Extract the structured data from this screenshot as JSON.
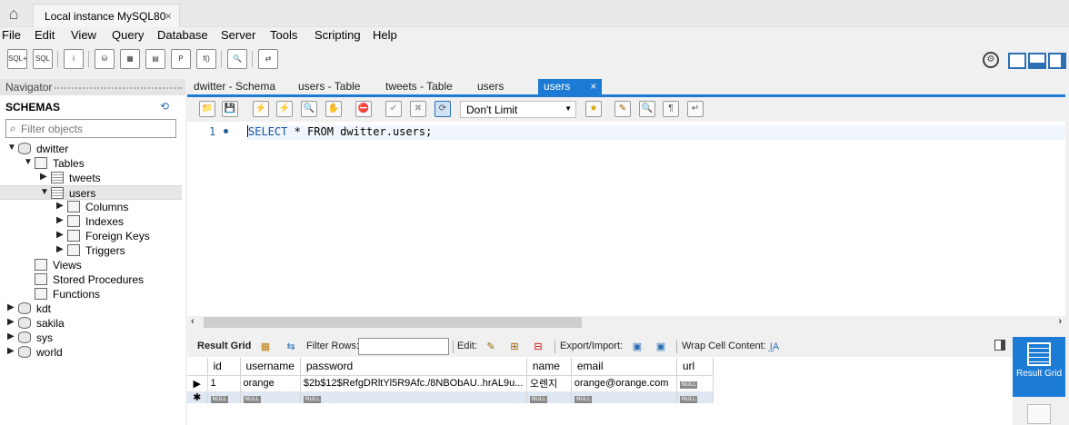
{
  "top": {
    "connection_tab": "Local instance MySQL80",
    "close_glyph": "×",
    "home_icon": "home-icon"
  },
  "menu": [
    "File",
    "Edit",
    "View",
    "Query",
    "Database",
    "Server",
    "Tools",
    "Scripting",
    "Help"
  ],
  "toolbar": {
    "icons": [
      "new-sql-tab-icon",
      "open-sql-script-icon",
      "info-icon",
      "create-schema-icon",
      "create-table-icon",
      "create-view-icon",
      "create-procedure-icon",
      "create-function-icon",
      "search-table-icon",
      "reconnect-icon"
    ],
    "glyphs": [
      "SQL+",
      "SQL",
      "i",
      "⛁",
      "▦",
      "▤",
      "P",
      "f()",
      "🔍",
      "⇄"
    ]
  },
  "navigator": {
    "header": "Navigator",
    "schemas_label": "SCHEMAS",
    "filter_placeholder": "Filter objects",
    "tree": [
      {
        "label": "dwitter",
        "kind": "db",
        "indent": 0,
        "twisty": "▼"
      },
      {
        "label": "Tables",
        "kind": "fold",
        "indent": 1,
        "twisty": "▼"
      },
      {
        "label": "tweets",
        "kind": "tbl",
        "indent": 2,
        "twisty": "▶"
      },
      {
        "label": "users",
        "kind": "tbl",
        "indent": 2,
        "twisty": "▼",
        "selected": true
      },
      {
        "label": "Columns",
        "kind": "fold",
        "indent": 3,
        "twisty": "▶"
      },
      {
        "label": "Indexes",
        "kind": "fold",
        "indent": 3,
        "twisty": "▶"
      },
      {
        "label": "Foreign Keys",
        "kind": "fold",
        "indent": 3,
        "twisty": "▶"
      },
      {
        "label": "Triggers",
        "kind": "fold",
        "indent": 3,
        "twisty": "▶"
      },
      {
        "label": "Views",
        "kind": "fold",
        "indent": 1,
        "twisty": ""
      },
      {
        "label": "Stored Procedures",
        "kind": "fold",
        "indent": 1,
        "twisty": ""
      },
      {
        "label": "Functions",
        "kind": "fold",
        "indent": 1,
        "twisty": ""
      },
      {
        "label": "kdt",
        "kind": "db",
        "indent": 0,
        "twisty": "▶"
      },
      {
        "label": "sakila",
        "kind": "db",
        "indent": 0,
        "twisty": "▶"
      },
      {
        "label": "sys",
        "kind": "db",
        "indent": 0,
        "twisty": "▶"
      },
      {
        "label": "world",
        "kind": "db",
        "indent": 0,
        "twisty": "▶"
      }
    ]
  },
  "editor_tabs": [
    "dwitter - Schema",
    "users - Table",
    "tweets - Table",
    "users",
    "users"
  ],
  "active_tab_index": 4,
  "sql_toolbar": {
    "limit": "Don't Limit",
    "icons": [
      "open-file-icon",
      "save-icon",
      "execute-icon",
      "execute-current-icon",
      "explain-icon",
      "stop-icon",
      "toggle-error-icon",
      "commit-icon",
      "rollback-icon",
      "autocommit-icon",
      "add-snippet-icon",
      "beautify-icon",
      "find-icon",
      "invisible-chars-icon",
      "wrap-icon"
    ],
    "glyphs": [
      "📁",
      "💾",
      "⚡",
      "⚡",
      "🔍",
      "✋",
      "⛔",
      "✔",
      "✖",
      "⟳",
      "★",
      "✎",
      "🔍",
      "¶",
      "↵"
    ]
  },
  "editor": {
    "line_number": "1",
    "keyword_select": "SELECT",
    "sql_rest": " * FROM dwitter.users;"
  },
  "result_toolbar": {
    "result_grid": "Result Grid",
    "filter_rows": "Filter Rows:",
    "edit": "Edit:",
    "export_import": "Export/Import:",
    "wrap_cell": "Wrap Cell Content:"
  },
  "grid": {
    "columns": [
      "id",
      "username",
      "password",
      "name",
      "email",
      "url"
    ],
    "rows": [
      [
        "1",
        "orange",
        "$2b$12$RefgDRltYl5R9Afc./8NBObAU..hrAL9u...",
        "오렌지",
        "orange@orange.com",
        "NULL"
      ]
    ],
    "null_label": "NULL",
    "current_row_marker": "▶",
    "new_row_marker": "✱"
  },
  "side_panel": {
    "result_grid_label": "Result Grid"
  },
  "colors": {
    "accent": "#1c7bd4",
    "keyword": "#1756a5"
  }
}
